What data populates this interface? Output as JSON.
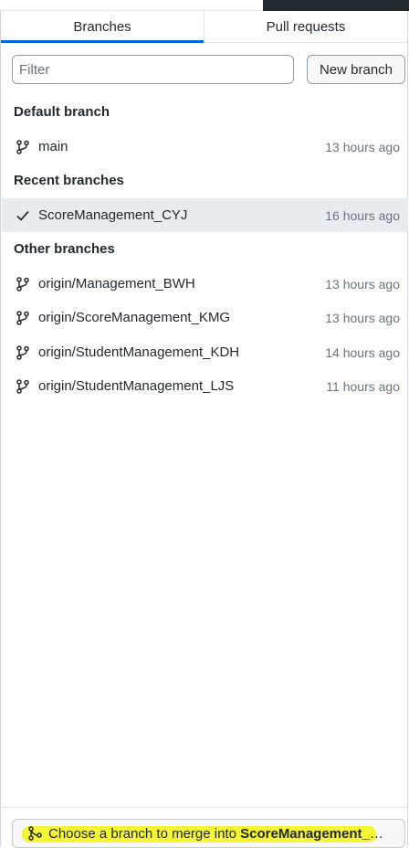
{
  "tabs": [
    {
      "label": "Branches",
      "active": true
    },
    {
      "label": "Pull requests",
      "active": false
    }
  ],
  "filter": {
    "placeholder": "Filter",
    "value": ""
  },
  "new_branch_label": "New branch",
  "sections": {
    "default": {
      "title": "Default branch",
      "items": [
        {
          "name": "main",
          "time": "13 hours ago",
          "icon": "git-branch-icon"
        }
      ]
    },
    "recent": {
      "title": "Recent branches",
      "items": [
        {
          "name": "ScoreManagement_CYJ",
          "time": "16 hours ago",
          "icon": "check-icon",
          "selected": true
        }
      ]
    },
    "other": {
      "title": "Other branches",
      "items": [
        {
          "name": "origin/Management_BWH",
          "time": "13 hours ago",
          "icon": "git-branch-icon"
        },
        {
          "name": "origin/ScoreManagement_KMG",
          "time": "13 hours ago",
          "icon": "git-branch-icon"
        },
        {
          "name": "origin/StudentManagement_KDH",
          "time": "14 hours ago",
          "icon": "git-branch-icon"
        },
        {
          "name": "origin/StudentManagement_LJS",
          "time": "11 hours ago",
          "icon": "git-branch-icon"
        }
      ]
    }
  },
  "merge_button": {
    "prefix": "Choose a branch to merge into ",
    "target": "ScoreManagement_CYJ",
    "icon": "git-merge-icon",
    "highlight_color": "#f4f414"
  },
  "colors": {
    "accent": "#0366d6",
    "selected_row": "#e9ecef",
    "muted": "#6a737d"
  }
}
